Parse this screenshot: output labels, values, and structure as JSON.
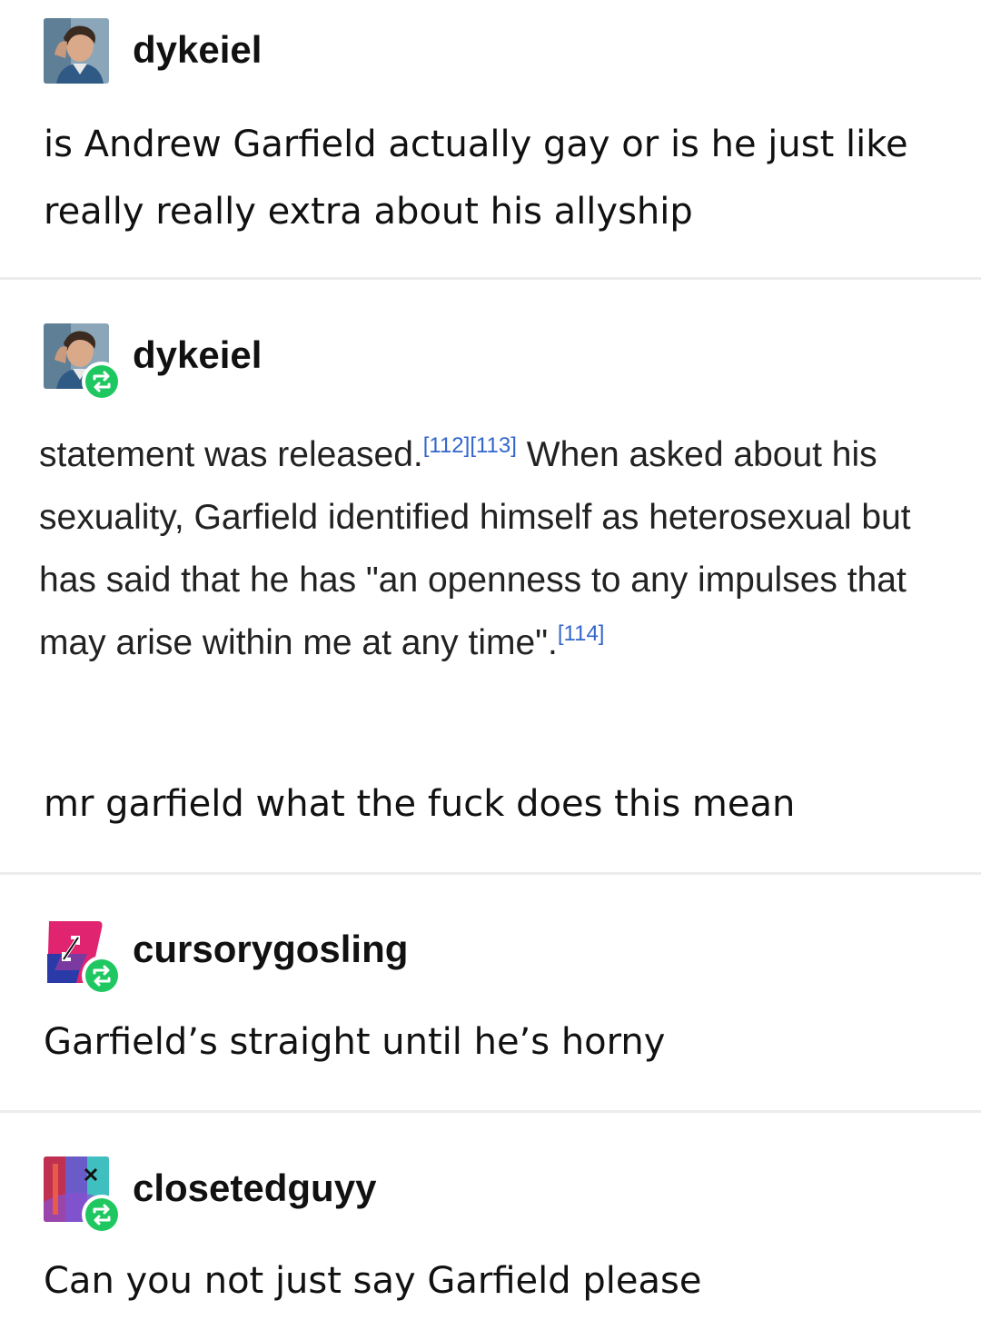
{
  "posts": [
    {
      "username": "dykeiel",
      "reblog": false,
      "text": "is Andrew Garfield actually gay or is he just like really really extra about his allyship"
    },
    {
      "username": "dykeiel",
      "reblog": true,
      "quote": {
        "s1": "statement was released.",
        "c1": "[112][113]",
        "s2": " When asked about his sexuality, Garfield identified himself as heterosexual but has said that he has \"an openness to any impulses that may arise within me at any time\".",
        "c2": "[114]"
      },
      "text": "mr garfield what the fuck does this mean"
    },
    {
      "username": "cursorygosling",
      "reblog": true,
      "text": "Garfield’s straight until he’s horny"
    },
    {
      "username": "closetedguyy",
      "reblog": true,
      "text": "Can you not just say Garfield please"
    }
  ],
  "colors": {
    "reblog_badge": "#1fc760",
    "divider": "#ececec",
    "citation": "#3366cc"
  },
  "icons": {
    "reblog": "reblog-arrows-icon"
  }
}
